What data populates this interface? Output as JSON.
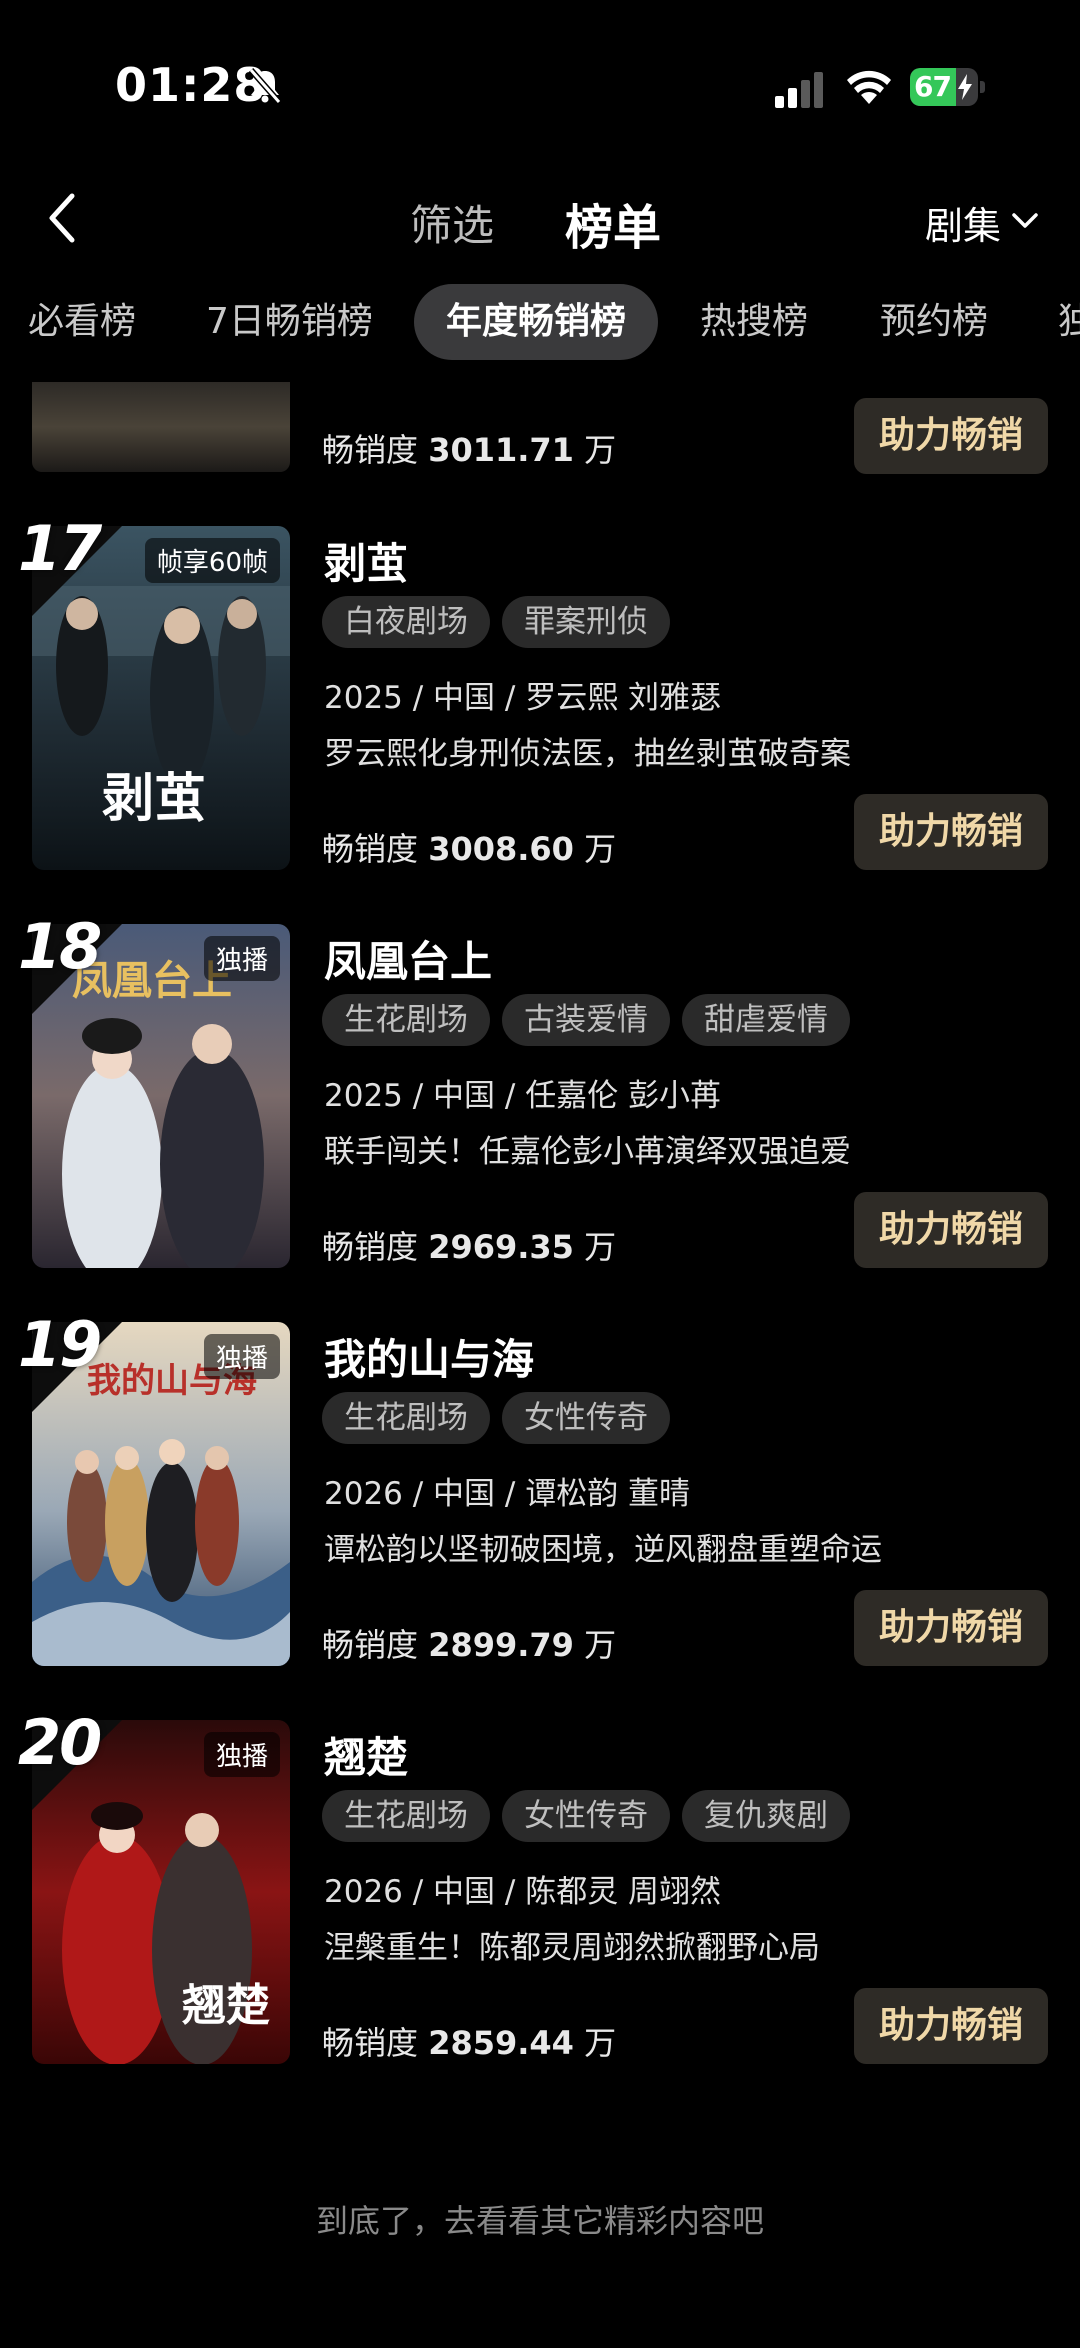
{
  "status_bar": {
    "time": "01:28",
    "battery_percent": "67",
    "battery_level": 0.67,
    "icons": [
      "bell-muted-icon",
      "signal-icon",
      "wifi-icon",
      "battery-charging-icon"
    ]
  },
  "header": {
    "back_icon": "chevron-left-icon",
    "filter_label": "筛选",
    "rank_label": "榜单",
    "category_label": "剧集",
    "category_icon": "chevron-down-icon"
  },
  "tabs": [
    {
      "label": "必看榜",
      "active": false
    },
    {
      "label": "7日畅销榜",
      "active": false
    },
    {
      "label": "年度畅销榜",
      "active": true
    },
    {
      "label": "热搜榜",
      "active": false
    },
    {
      "label": "预约榜",
      "active": false
    },
    {
      "label": "独",
      "active": false
    }
  ],
  "boost_label": "助力畅销",
  "partial_item": {
    "score_label": "畅销度",
    "score_value": "3011.71",
    "score_unit": "万"
  },
  "items": [
    {
      "rank": "17",
      "badge": "帧享60帧",
      "poster_text": "剥茧",
      "title": "剥茧",
      "tags": [
        "白夜剧场",
        "罪案刑侦"
      ],
      "meta": "2025 / 中国 / 罗云熙 刘雅瑟",
      "desc": "罗云熙化身刑侦法医，抽丝剥茧破奇案",
      "score_label": "畅销度",
      "score_value": "3008.60",
      "score_unit": "万"
    },
    {
      "rank": "18",
      "badge": "独播",
      "poster_text": "凤凰台上",
      "title": "凤凰台上",
      "tags": [
        "生花剧场",
        "古装爱情",
        "甜虐爱情"
      ],
      "meta": "2025 / 中国 / 任嘉伦 彭小苒",
      "desc": "联手闯关！任嘉伦彭小苒演绎双强追爱",
      "score_label": "畅销度",
      "score_value": "2969.35",
      "score_unit": "万"
    },
    {
      "rank": "19",
      "badge": "独播",
      "poster_text": "我的山与海",
      "title": "我的山与海",
      "tags": [
        "生花剧场",
        "女性传奇"
      ],
      "meta": "2026 / 中国 / 谭松韵 董晴",
      "desc": "谭松韵以坚韧破困境，逆风翻盘重塑命运",
      "score_label": "畅销度",
      "score_value": "2899.79",
      "score_unit": "万"
    },
    {
      "rank": "20",
      "badge": "独播",
      "poster_text": "翘楚",
      "title": "翘楚",
      "tags": [
        "生花剧场",
        "女性传奇",
        "复仇爽剧"
      ],
      "meta": "2026 / 中国 / 陈都灵 周翊然",
      "desc": "涅槃重生！陈都灵周翊然掀翻野心局",
      "score_label": "畅销度",
      "score_value": "2859.44",
      "score_unit": "万"
    }
  ],
  "bottom_note": "到底了，去看看其它精彩内容吧"
}
